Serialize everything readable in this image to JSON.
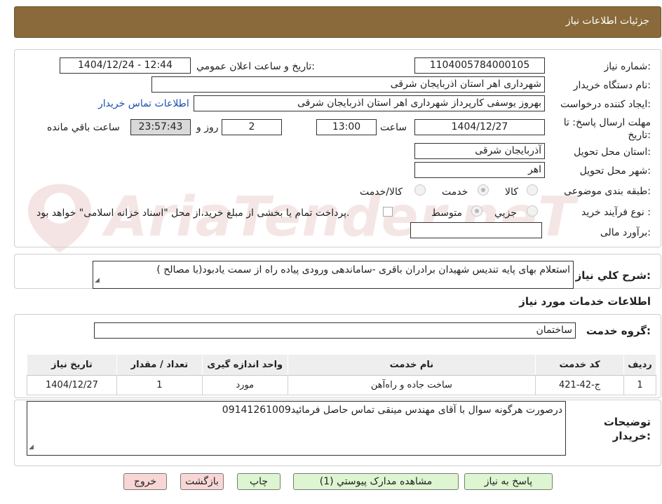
{
  "header": {
    "title": "جزئیات اطلاعات نیاز"
  },
  "form": {
    "need_number_label": "شماره نیاز:",
    "need_number": "1104005784000105",
    "announce_label": "تاریخ و ساعت اعلان عمومي:",
    "announce_value": "1404/12/24 - 12:44",
    "buyer_org_label": "نام دستگاه خريدار:",
    "buyer_org": "شهرداری اهر استان اذربایجان شرقی",
    "creator_label": "ايجاد کننده درخواست:",
    "creator": "بهروز یوسفی کارپرداز شهرداری اهر استان اذربایجان شرقی",
    "contact_link": "اطلاعات تماس خريدار",
    "deadline_label": "مهلت ارسال پاسخ: تا تاريخ:",
    "deadline_date": "1404/12/27",
    "time_label": "ساعت",
    "deadline_time": "13:00",
    "days_value": "2",
    "days_label": "روز و",
    "remaining_time": "23:57:43",
    "remaining_label": "ساعت باقي مانده",
    "province_label": "استان محل تحويل:",
    "province": "آذربایجان شرقی",
    "city_label": "شهر محل تحويل:",
    "city": "اهر",
    "category_label": "طبقه بندی موضوعی:",
    "category_options": [
      "کالا",
      "خدمت",
      "کالا/خدمت"
    ],
    "process_label": "نوع فرآيند خريد :",
    "process_options": [
      "جزيي",
      "متوسط"
    ],
    "payment_note": "پرداخت تمام یا بخشی از مبلغ خرید،از محل \"اسناد خزانه اسلامی\" خواهد بود.",
    "budget_label": "برآورد مالی:",
    "budget_value": ""
  },
  "description": {
    "label": "شرح کلي نياز:",
    "text": "استعلام بهای پایه تندیس شهیدان برادران باقری -ساماندهی ورودی پیاده راه از سمت یادبود(با مصالح )"
  },
  "services": {
    "title": "اطلاعات خدمات مورد نياز",
    "group_label": "گروه خدمت:",
    "group_value": "ساختمان",
    "columns": [
      "رديف",
      "کد خدمت",
      "نام خدمت",
      "واحد اندازه گيری",
      "تعداد / مقدار",
      "تاريخ نياز"
    ],
    "rows": [
      [
        "1",
        "ج-42-421",
        "ساخت جاده و راه‌آهن",
        "مورد",
        "1",
        "1404/12/27"
      ]
    ]
  },
  "buyer_notes": {
    "label": "توضيحات خريدار:",
    "text": "درصورت هرگونه سوال با آقای مهندس مینقی تماس حاصل فرمائید09141261009"
  },
  "buttons": {
    "reply": "پاسخ به نياز",
    "attachments": "مشاهده مدارک پيوستي (1)",
    "print": "چاپ",
    "back": "بازگشت",
    "exit": "خروج"
  },
  "watermark": {
    "text": "AriaTender.neT"
  },
  "colors": {
    "header_bg": "#8a6a3a",
    "link": "#1b4fb3",
    "green_btn": "#ddf5d0",
    "pink_btn": "#f9d6d6"
  }
}
